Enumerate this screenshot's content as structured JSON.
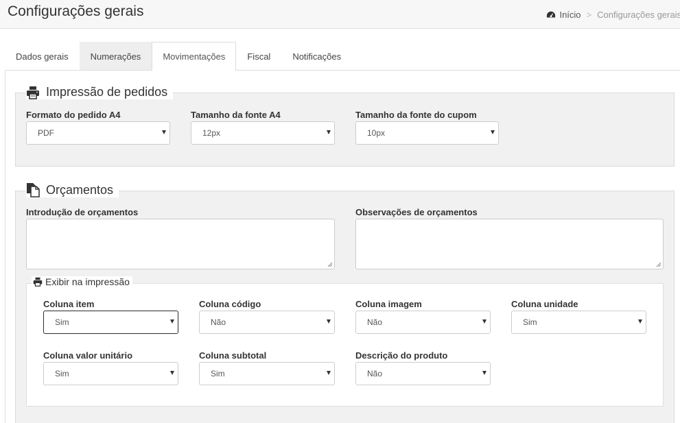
{
  "header": {
    "title": "Configurações gerais",
    "breadcrumb": {
      "home": "Início",
      "separator": ">",
      "current": "Configurações gerais"
    }
  },
  "tabs": [
    {
      "label": "Dados gerais"
    },
    {
      "label": "Numerações"
    },
    {
      "label": "Movimentações"
    },
    {
      "label": "Fiscal"
    },
    {
      "label": "Notificações"
    }
  ],
  "active_tab": "Movimentações",
  "impressao": {
    "title": "Impressão de pedidos",
    "icon": "printer-icon",
    "fields": [
      {
        "label": "Formato do pedido A4",
        "value": "PDF"
      },
      {
        "label": "Tamanho da fonte A4",
        "value": "12px"
      },
      {
        "label": "Tamanho da fonte do cupom",
        "value": "10px"
      }
    ]
  },
  "orcamentos": {
    "title": "Orçamentos",
    "icon": "copy-icon",
    "introducao_label": "Introdução de orçamentos",
    "introducao_value": "",
    "observacoes_label": "Observações de orçamentos",
    "observacoes_value": "",
    "exibir": {
      "title": "Exibir na impressão",
      "fields": [
        {
          "label": "Coluna item",
          "value": "Sim"
        },
        {
          "label": "Coluna código",
          "value": "Não"
        },
        {
          "label": "Coluna imagem",
          "value": "Não"
        },
        {
          "label": "Coluna unidade",
          "value": "Sim"
        },
        {
          "label": "Coluna valor unitário",
          "value": "Sim"
        },
        {
          "label": "Coluna subtotal",
          "value": "Sim"
        },
        {
          "label": "Descrição do produto",
          "value": "Não"
        }
      ]
    }
  },
  "colors": {
    "section_bg": "#f1f1f1",
    "border": "#dadada",
    "focus_border": "#333333"
  }
}
